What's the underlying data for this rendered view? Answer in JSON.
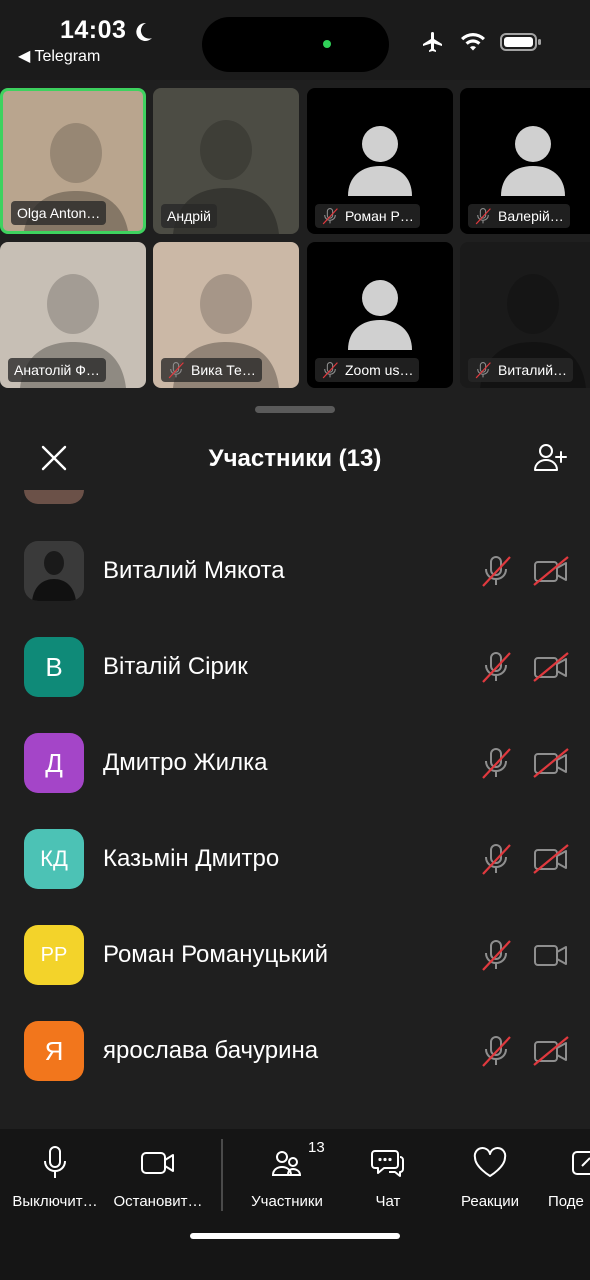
{
  "status_bar": {
    "time": "14:03",
    "back_app": "◀ Telegram"
  },
  "video_grid": [
    {
      "name": "Olga Anton…",
      "muted": false,
      "active": true,
      "bg": "#b9a58e"
    },
    {
      "name": "Андрій",
      "muted": false,
      "active": false,
      "bg": "#4c4c44"
    },
    {
      "name": "Роман Р…",
      "muted": true,
      "active": false,
      "bg": "#000000"
    },
    {
      "name": "Валерій…",
      "muted": true,
      "active": false,
      "bg": "#000000"
    },
    {
      "name": "Анатолій Ф…",
      "muted": false,
      "active": false,
      "bg": "#c7bfb5"
    },
    {
      "name": "Вика Те…",
      "muted": true,
      "active": false,
      "bg": "#cbb8a6"
    },
    {
      "name": "Zoom us…",
      "muted": true,
      "active": false,
      "bg": "#000000"
    },
    {
      "name": "Виталий…",
      "muted": true,
      "active": false,
      "bg": "#1a1a1a"
    }
  ],
  "sheet": {
    "title": "Участники (13)"
  },
  "participants": [
    {
      "name": "Виталий Мякота",
      "initials": "",
      "color": "#2b2b2b",
      "mic_muted": true,
      "cam_off": true
    },
    {
      "name": "Віталій Сірик",
      "initials": "В",
      "color": "#0f8a78",
      "mic_muted": true,
      "cam_off": true
    },
    {
      "name": "Дмитро Жилка",
      "initials": "Д",
      "color": "#a445c8",
      "mic_muted": true,
      "cam_off": true
    },
    {
      "name": "Казьмін Дмитро",
      "initials": "КД",
      "color": "#4cc2b5",
      "mic_muted": true,
      "cam_off": true
    },
    {
      "name": "Роман Романуцький",
      "initials": "РР",
      "color": "#f3d32a",
      "mic_muted": true,
      "cam_off": false
    },
    {
      "name": "ярослава бачурина",
      "initials": "Я",
      "color": "#f2761c",
      "mic_muted": true,
      "cam_off": true
    }
  ],
  "toolbar": {
    "mute_label": "Выключит…",
    "video_label": "Остановит…",
    "participants_label": "Участники",
    "participants_count": "13",
    "chat_label": "Чат",
    "reactions_label": "Реакции",
    "share_label": "Поде"
  },
  "colors": {
    "accent_green": "#3ed25f",
    "muted_red": "#e0393e"
  }
}
